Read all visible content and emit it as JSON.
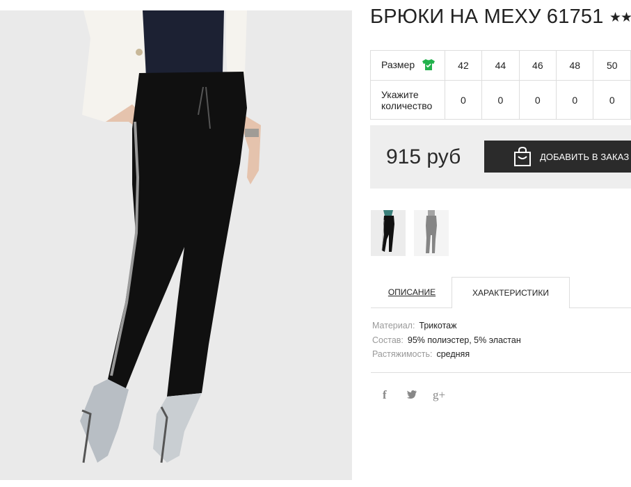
{
  "product": {
    "title": "БРЮКИ НА МЕХУ 61751",
    "stars": "★★"
  },
  "size_table": {
    "size_label": "Размер",
    "qty_label": "Укажите количество",
    "sizes": [
      "42",
      "44",
      "46",
      "48",
      "50"
    ],
    "quantities": [
      "0",
      "0",
      "0",
      "0",
      "0"
    ]
  },
  "price": {
    "value": "915 руб",
    "add_button_label": "ДОБАВИТЬ В ЗАКАЗ"
  },
  "tabs": {
    "description": "ОПИСАНИЕ",
    "characteristics": "ХАРАКТЕРИСТИКИ"
  },
  "specs": [
    {
      "key": "Материал:",
      "value": "Трикотаж"
    },
    {
      "key": "Состав:",
      "value": "95% полиэстер, 5% эластан"
    },
    {
      "key": "Растяжимость:",
      "value": "средняя"
    }
  ],
  "social": {
    "facebook_glyph": "f",
    "twitter_glyph": "🐦",
    "gplus_glyph": "g+"
  },
  "colors": {
    "accent_green": "#22b14c",
    "button_dark": "#2b2b2b",
    "price_bg": "#eeeeee"
  }
}
